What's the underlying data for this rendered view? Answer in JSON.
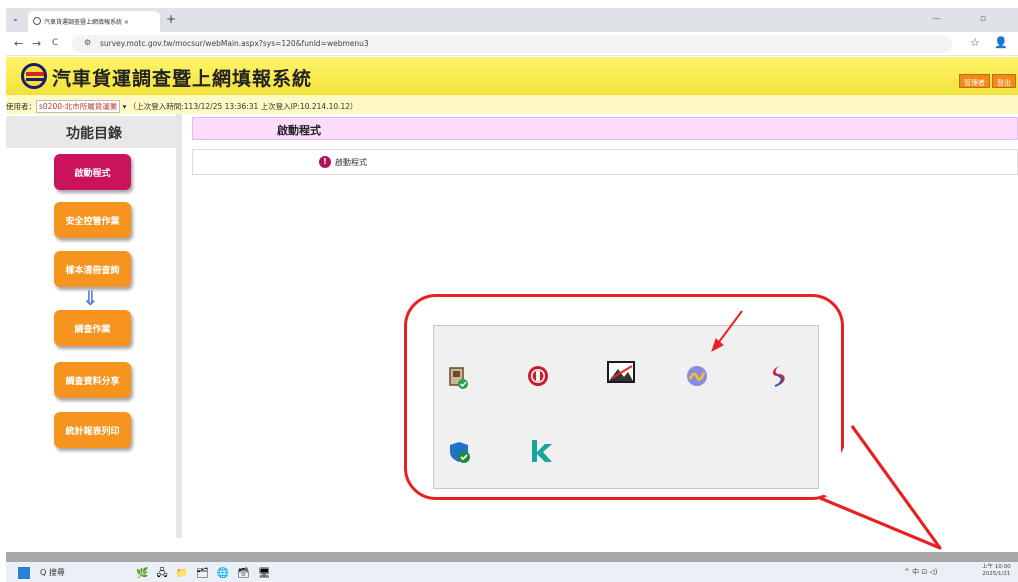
{
  "browser": {
    "tab_title": "汽車貨運調查暨上網填報系統 ×",
    "url": "survey.motc.gov.tw/mocsur/webMain.aspx?sys=120&funId=webmenu3",
    "back_glyph": "←",
    "forward_glyph": "→",
    "reload_glyph": "C",
    "tab_list_glyph": "⌄",
    "new_tab_glyph": "+",
    "window_controls": "— ▫",
    "star_glyph": "☆",
    "profile_glyph": "👤",
    "address_icon_glyph": "⚙"
  },
  "header": {
    "title": "汽車貨運調查暨上網填報系統",
    "admin_button": "管理者",
    "logout_button": "登出"
  },
  "userbar": {
    "prefix": "使用者：",
    "user": "s0200-北市所屬貨運業",
    "dropdown_glyph": "▾",
    "info": "（上次登入時間:113/12/25 13:36:31 上次登入IP:10.214.10.12）"
  },
  "sidebar": {
    "title": "功能目錄",
    "items": [
      {
        "label": "啟動程式",
        "active": true
      },
      {
        "label": "安全控管作業",
        "active": false
      },
      {
        "label": "樣本清冊查詢",
        "active": false
      },
      {
        "label": "調查作業",
        "active": false
      },
      {
        "label": "調查資料分享",
        "active": false
      },
      {
        "label": "統計報表列印",
        "active": false
      }
    ],
    "flow_arrow": "⇓"
  },
  "main": {
    "heading": "啟動程式",
    "info_icon_glyph": "!",
    "panel_label": "啟動程式"
  },
  "callout": {
    "icons": [
      "certificate-icon",
      "round-seal-icon",
      "image-tool-icon",
      "launcher-icon",
      "swirl-logo-icon",
      "shield-check-icon",
      "k-app-icon"
    ]
  },
  "taskbar": {
    "search_label": "Q 搜尋",
    "tray_text": "^ 中 ⊡ ◁)",
    "clock_time": "上午 10:00",
    "clock_date": "2025/1/21",
    "apps": [
      "🌿",
      "🖧",
      "📁",
      "🗂",
      "🌐",
      "🗃",
      "🖥"
    ]
  },
  "colors": {
    "header_yellow": "#f2e13a",
    "menu_orange": "#f5941f",
    "menu_active": "#c9135c",
    "callout_red": "#e8201f",
    "heading_pink": "#fcdcfc"
  }
}
